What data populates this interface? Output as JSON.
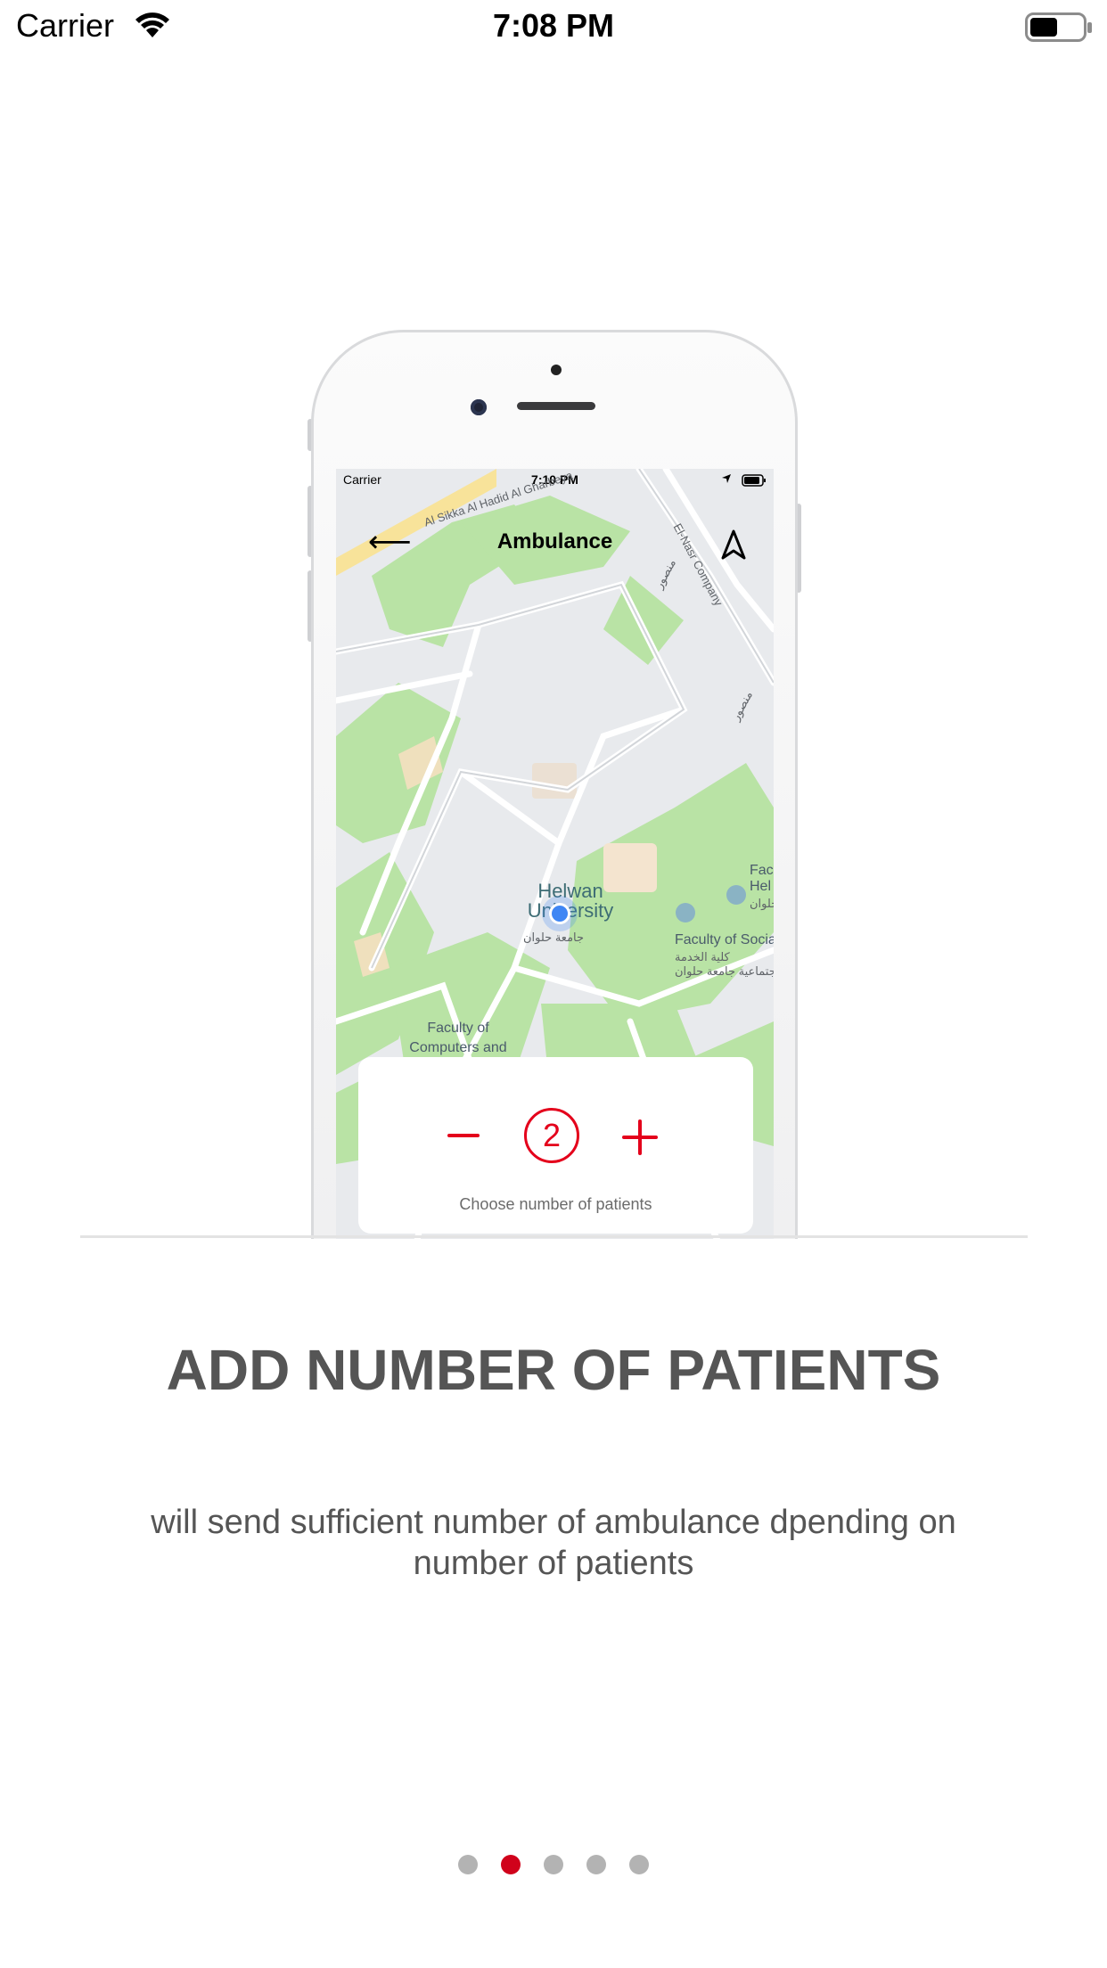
{
  "status_bar": {
    "carrier": "Carrier",
    "time": "7:08 PM",
    "wifi_icon": "wifi-icon",
    "battery_icon": "battery-icon"
  },
  "mockup": {
    "status_bar": {
      "carrier": "Carrier",
      "time": "7:10 PM"
    },
    "title": "Ambulance",
    "back_icon": "back-arrow-icon",
    "navigation_icon": "navigation-arrow-icon",
    "map_labels": {
      "road_1": "Al Sikka Al Hadid Al Gharbeya",
      "road_2": "El-Nasr Company",
      "arabic_road": "منصور",
      "arabic_road_2": "منصور",
      "university": "Helwan University",
      "university_arabic": "جامعة حلوان",
      "faculty_social": "Faculty of Socia",
      "faculty_social_arabic": "كلية الخدمة",
      "faculty_social_arabic_2": "الاجتماعية جامعة حلوان",
      "faculty_computers": "Faculty of Computers and",
      "faculty_he": "Fac Hel",
      "faculty_he_arabic": "حلوان"
    },
    "patients": {
      "count": "2",
      "label": "Choose number of patients",
      "accent_color": "#e4001b"
    }
  },
  "onboarding": {
    "headline": "ADD NUMBER OF PATIENTS",
    "description": "will send sufficient number of ambulance dpending on number of patients",
    "pages": 5,
    "active_page": 2,
    "active_color": "#d0021b"
  }
}
